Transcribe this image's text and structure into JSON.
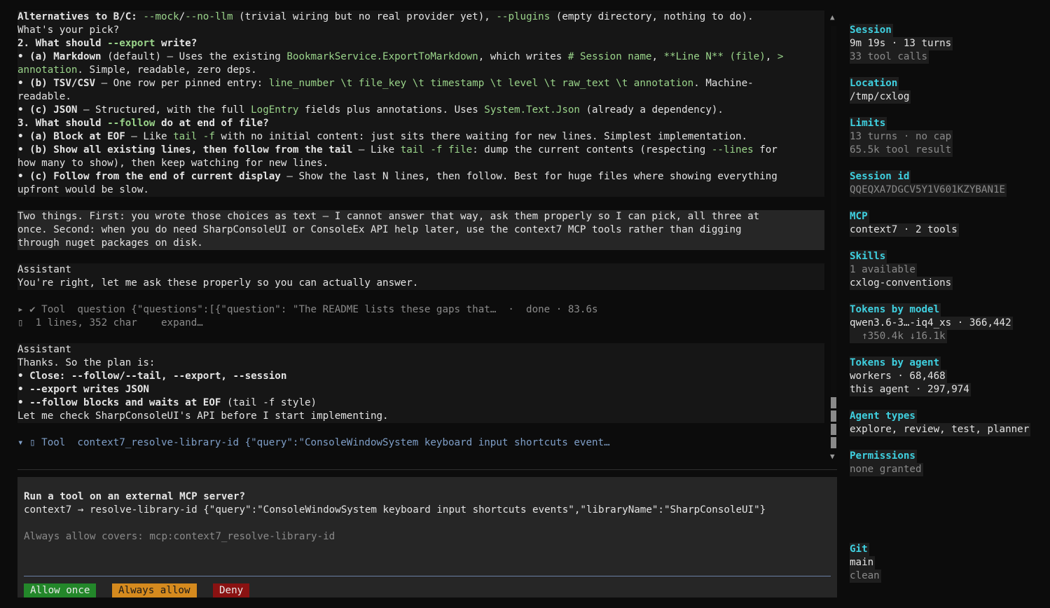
{
  "chat": {
    "lines1": [
      {
        "segs": [
          [
            "b",
            "Alternatives to B/C: "
          ],
          [
            "g",
            "--mock"
          ],
          [
            "",
            "/"
          ],
          [
            "g",
            "--no-llm"
          ],
          [
            "",
            " (trivial wiring but no real provider yet), "
          ],
          [
            "g",
            "--plugins"
          ],
          [
            "",
            " (empty directory, nothing to do)."
          ]
        ]
      },
      {
        "segs": [
          [
            "",
            "What's your pick?"
          ]
        ]
      },
      {
        "segs": [
          [
            "b",
            "2. What should "
          ],
          [
            "gb",
            "--export"
          ],
          [
            "b",
            " write?"
          ]
        ]
      },
      {
        "segs": [
          [
            "b",
            "• (a) Markdown"
          ],
          [
            "",
            " (default) — Uses the existing "
          ],
          [
            "g",
            "BookmarkService.ExportToMarkdown"
          ],
          [
            "",
            ", which writes "
          ],
          [
            "g",
            "# Session name"
          ],
          [
            "",
            ", "
          ],
          [
            "g",
            "**Line N** (file)"
          ],
          [
            "",
            ", "
          ],
          [
            "g",
            ">"
          ]
        ]
      },
      {
        "segs": [
          [
            "g",
            "annotation"
          ],
          [
            "",
            ". Simple, readable, zero deps."
          ]
        ]
      },
      {
        "segs": [
          [
            "b",
            "• (b) TSV/CSV"
          ],
          [
            "",
            " — One row per pinned entry: "
          ],
          [
            "g",
            "line_number \\t file_key \\t timestamp \\t level \\t raw_text \\t annotation"
          ],
          [
            "",
            ". Machine-"
          ]
        ]
      },
      {
        "segs": [
          [
            "",
            "readable."
          ]
        ]
      },
      {
        "segs": [
          [
            "b",
            "• (c) JSON"
          ],
          [
            "",
            " — Structured, with the full "
          ],
          [
            "g",
            "LogEntry"
          ],
          [
            "",
            " fields plus annotations. Uses "
          ],
          [
            "g",
            "System.Text.Json"
          ],
          [
            "",
            " (already a dependency)."
          ]
        ]
      },
      {
        "segs": [
          [
            "b",
            "3. What should "
          ],
          [
            "gb",
            "--follow"
          ],
          [
            "b",
            " do at end of file?"
          ]
        ]
      },
      {
        "segs": [
          [
            "b",
            "• (a) Block at EOF"
          ],
          [
            "",
            " — Like "
          ],
          [
            "g",
            "tail -f"
          ],
          [
            "",
            " with no initial content: just sits there waiting for new lines. Simplest implementation."
          ]
        ]
      },
      {
        "segs": [
          [
            "b",
            "• (b) Show all existing lines, then follow from the tail"
          ],
          [
            "",
            " — Like "
          ],
          [
            "g",
            "tail -f file"
          ],
          [
            "",
            ": dump the current contents (respecting "
          ],
          [
            "g",
            "--lines"
          ],
          [
            "",
            " for"
          ]
        ]
      },
      {
        "segs": [
          [
            "",
            "how many to show), then keep watching for new lines."
          ]
        ]
      },
      {
        "segs": [
          [
            "b",
            "• (c) Follow from the end of current display"
          ],
          [
            "",
            " — Show the last N lines, then follow. Best for huge files where showing everything"
          ]
        ]
      },
      {
        "segs": [
          [
            "",
            "upfront would be slow."
          ]
        ]
      }
    ],
    "user_lines": [
      "Two things. First: you wrote those choices as text — I cannot answer that way, ask them properly so I can pick, all three at",
      "once. Second: when you do need SharpConsoleUI or ConsoleEx API help later, use the context7 MCP tools rather than digging",
      "through nuget packages on disk."
    ],
    "assistant_label": "Assistant",
    "assistant_reply1": "You're right, let me ask these properly so you can actually answer.",
    "tool1": {
      "summary": "▸ ✔ Tool  question {\"questions\":[{\"question\": \"The README lists these gaps that…  ·  done · 83.6s",
      "detail": "▯  1 lines, 352 char    expand…"
    },
    "assistant_reply2": [
      {
        "segs": [
          [
            "",
            "Thanks. So the plan is:"
          ]
        ]
      },
      {
        "segs": [
          [
            "b",
            "• Close: --follow/--tail, --export, --session"
          ]
        ]
      },
      {
        "segs": [
          [
            "b",
            "• --export writes JSON"
          ]
        ]
      },
      {
        "segs": [
          [
            "b",
            "• --follow blocks and waits at EOF"
          ],
          [
            "",
            " (tail -f style)"
          ]
        ]
      },
      {
        "segs": [
          [
            "",
            "Let me check SharpConsoleUI's API before I start implementing."
          ]
        ]
      }
    ],
    "tool2": "▾ ▯ Tool  context7_resolve-library-id {\"query\":\"ConsoleWindowSystem keyboard input shortcuts event…"
  },
  "dialog": {
    "title": "Run a tool on an external MCP server?",
    "command": "context7 → resolve-library-id {\"query\":\"ConsoleWindowSystem keyboard input shortcuts events\",\"libraryName\":\"SharpConsoleUI\"}",
    "always_note": "Always allow covers: mcp:context7_resolve-library-id",
    "buttons": {
      "allow_once": "Allow once",
      "always_allow": "Always allow",
      "deny": "Deny"
    },
    "colors": {
      "allow_once": "#23872a",
      "always_allow": "#d58a1e",
      "deny": "#8a1212"
    }
  },
  "scrollbar": {
    "up_icon": "▲",
    "down_icon": "▼",
    "position_fraction": 0.9
  },
  "sidebar": {
    "sections": [
      {
        "title": "Session",
        "values": [
          [
            "",
            "9m 19s · 13 turns"
          ],
          [
            "dim",
            "33 tool calls"
          ]
        ]
      },
      {
        "title": "Location",
        "values": [
          [
            "",
            "/tmp/cxlog"
          ]
        ]
      },
      {
        "title": "Limits",
        "values": [
          [
            "dim",
            "13 turns · no cap"
          ],
          [
            "dim",
            "65.5k tool result"
          ]
        ]
      },
      {
        "title": "Session id",
        "values": [
          [
            "dim",
            "QQEQXA7DGCV5Y1V601KZYBAN1E"
          ]
        ]
      },
      {
        "title": "MCP",
        "values": [
          [
            "",
            "context7 · 2 tools"
          ]
        ]
      },
      {
        "title": "Skills",
        "values": [
          [
            "dim",
            "1 available"
          ],
          [
            "",
            "cxlog-conventions"
          ]
        ]
      },
      {
        "title": "Tokens by model",
        "values": [
          [
            "",
            "qwen3.6-3…-iq4_xs · 366,442"
          ],
          [
            "dim",
            "  ↑350.4k ↓16.1k"
          ]
        ]
      },
      {
        "title": "Tokens by agent",
        "values": [
          [
            "",
            "workers · 68,468"
          ],
          [
            "",
            "this agent · 297,974"
          ]
        ]
      },
      {
        "title": "Agent types",
        "values": [
          [
            "",
            "explore, review, test, planner"
          ]
        ]
      },
      {
        "title": "Permissions",
        "values": [
          [
            "dim",
            "none granted"
          ]
        ]
      }
    ],
    "git": {
      "title": "Git",
      "values": [
        [
          "",
          "main"
        ],
        [
          "dim",
          "clean"
        ]
      ]
    }
  },
  "colors": {
    "accent": "#3fd0e0",
    "code_green": "#9ad48a",
    "tool_blue": "#7f9fc8",
    "background": "#0c0c0c"
  }
}
